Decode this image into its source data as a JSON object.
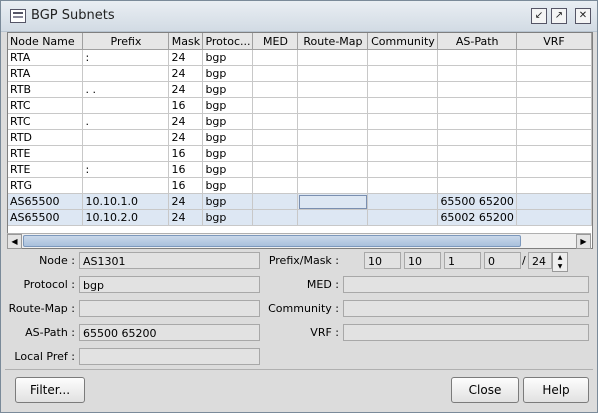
{
  "window": {
    "title": "BGP Subnets"
  },
  "table": {
    "columns": [
      "Node Name",
      "Prefix",
      "Mask",
      "Protoc...",
      "MED",
      "Route-Map",
      "Community",
      "AS-Path",
      "VRF"
    ],
    "rows": [
      [
        "RTA",
        ":",
        "24",
        "bgp",
        "",
        "",
        "",
        "",
        ""
      ],
      [
        "RTA",
        "",
        "24",
        "bgp",
        "",
        "",
        "",
        "",
        ""
      ],
      [
        "RTB",
        ". .",
        "24",
        "bgp",
        "",
        "",
        "",
        "",
        ""
      ],
      [
        "RTC",
        "",
        "16",
        "bgp",
        "",
        "",
        "",
        "",
        ""
      ],
      [
        "RTC",
        ".",
        "24",
        "bgp",
        "",
        "",
        "",
        "",
        ""
      ],
      [
        "RTD",
        "",
        "24",
        "bgp",
        "",
        "",
        "",
        "",
        ""
      ],
      [
        "RTE",
        "",
        "16",
        "bgp",
        "",
        "",
        "",
        "",
        ""
      ],
      [
        "RTE",
        ":",
        "16",
        "bgp",
        "",
        "",
        "",
        "",
        ""
      ],
      [
        "RTG",
        "",
        "16",
        "bgp",
        "",
        "",
        "",
        "",
        ""
      ],
      [
        "AS65500",
        "10.10.1.0",
        "24",
        "bgp",
        "",
        "",
        "",
        "65500 65200",
        ""
      ],
      [
        "AS65500",
        "10.10.2.0",
        "24",
        "bgp",
        "",
        "",
        "",
        "65002 65200",
        ""
      ]
    ]
  },
  "details": {
    "node_label": "Node :",
    "node_value": "AS1301",
    "protocol_label": "Protocol :",
    "protocol_value": "bgp",
    "routemap_label": "Route-Map :",
    "routemap_value": "",
    "aspath_label": "AS-Path :",
    "aspath_value": "65500 65200",
    "localpref_label": "Local Pref :",
    "localpref_value": "",
    "prefixmask_label": "Prefix/Mask :",
    "prefix_octets": [
      "10",
      "10",
      "1",
      "0"
    ],
    "mask_value": "24",
    "med_label": "MED :",
    "med_value": "",
    "community_label": "Community :",
    "community_value": "",
    "vrf_label": "VRF :",
    "vrf_value": ""
  },
  "buttons": {
    "filter": "Filter...",
    "close": "Close",
    "help": "Help"
  }
}
